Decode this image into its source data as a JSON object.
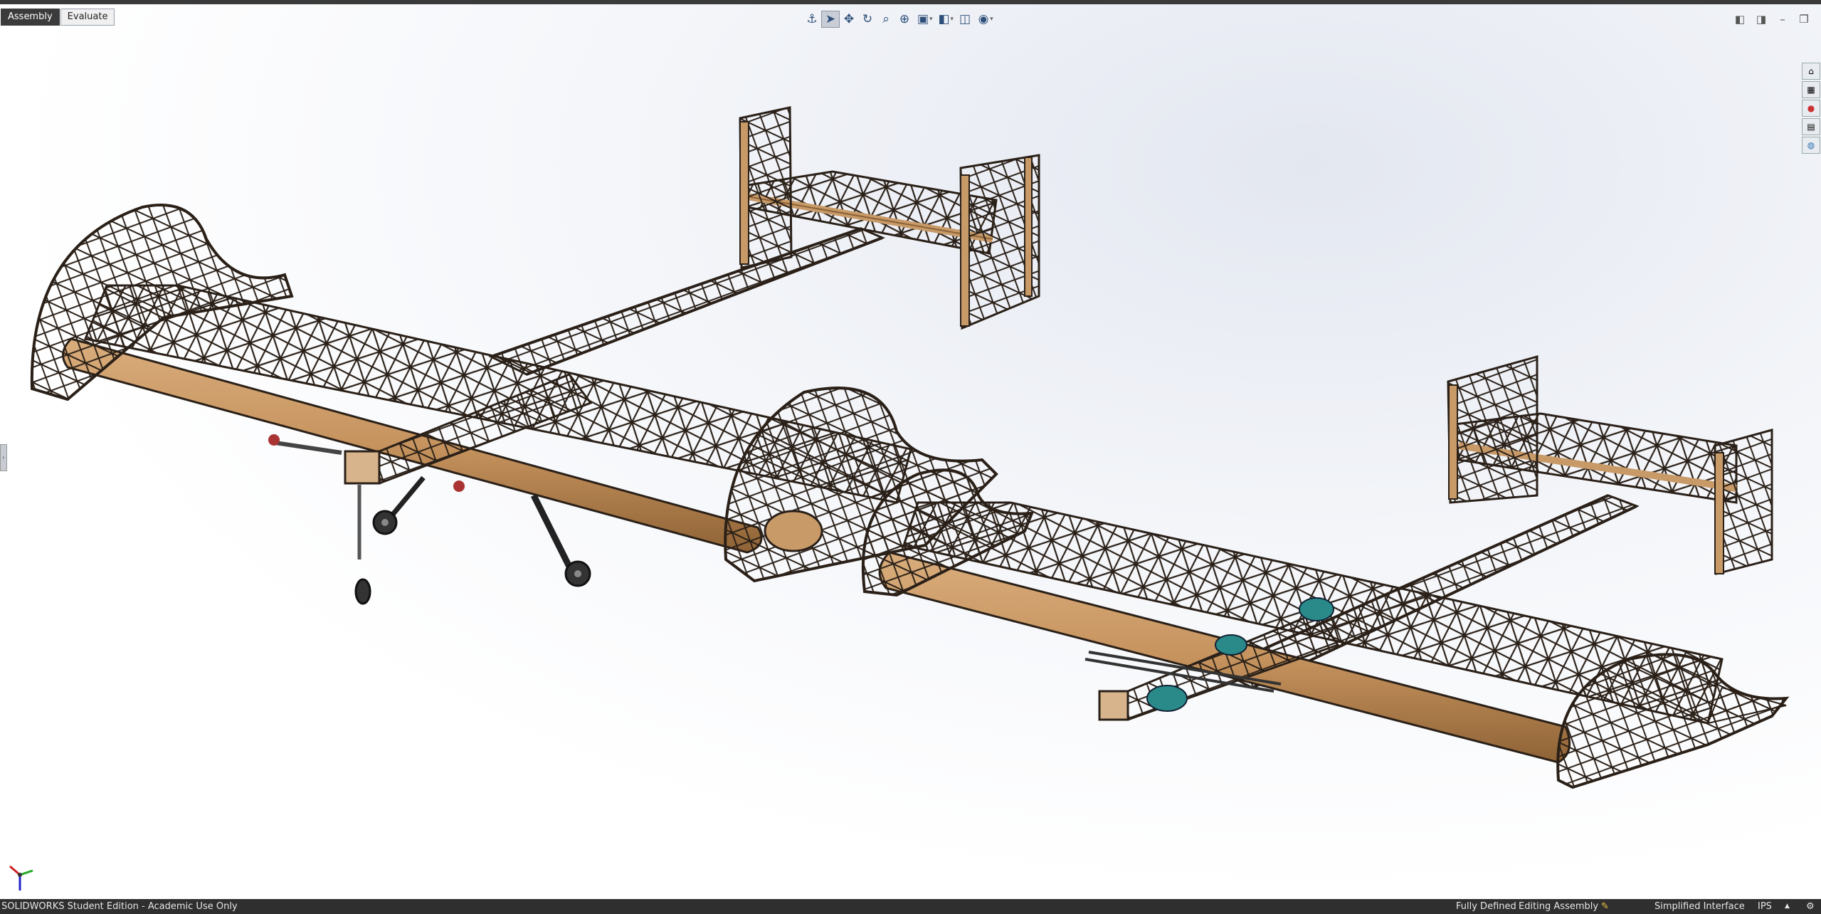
{
  "command_manager": {
    "tabs": [
      {
        "label": "Assembly",
        "active": true
      },
      {
        "label": "Evaluate",
        "active": false
      }
    ]
  },
  "heads_up_toolbar": {
    "buttons": [
      {
        "icon": "anchor-icon"
      },
      {
        "icon": "select-arrow-icon",
        "active": true
      },
      {
        "icon": "pan-icon"
      },
      {
        "icon": "rotate-icon"
      },
      {
        "icon": "zoom-icon"
      },
      {
        "icon": "zoom-area-icon"
      },
      {
        "icon": "view-orientation-icon",
        "dropdown": true
      },
      {
        "icon": "display-style-icon",
        "dropdown": true
      },
      {
        "icon": "section-view-icon"
      },
      {
        "icon": "appearance-icon",
        "dropdown": true
      }
    ]
  },
  "window_controls": [
    "tile-left-icon",
    "tile-right-icon",
    "minimize-icon",
    "restore-icon",
    "close-icon"
  ],
  "task_pane": [
    "resources-icon",
    "design-library-icon",
    "appearances-icon",
    "view-palette-icon",
    "custom-properties-icon"
  ],
  "statusbar": {
    "edition": "SOLIDWORKS Student Edition - Academic Use Only",
    "state": "Fully Defined",
    "mode": "Editing Assembly",
    "interface": "Simplified Interface",
    "units": "IPS"
  },
  "colors": {
    "frame": "#2a2018",
    "balsa": "#c89a68",
    "balsa_dark": "#8a6238",
    "motor": "#2a8a8a",
    "tab_active": "#3b3b3b",
    "statusbar": "#2f2f2f"
  }
}
